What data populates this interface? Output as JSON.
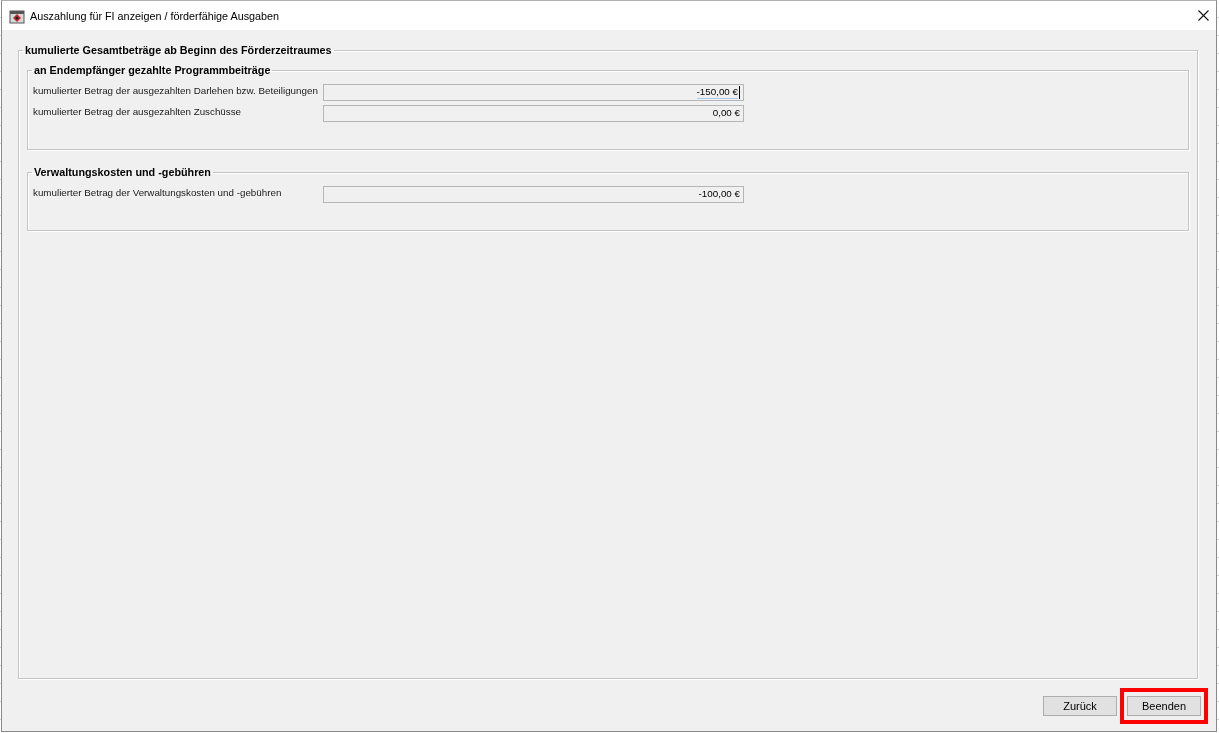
{
  "window": {
    "title": "Auszahlung für FI anzeigen / förderfähige Ausgaben"
  },
  "group": {
    "title": "kumulierte Gesamtbeträge ab Beginn des Förderzeitraumes",
    "sections": [
      {
        "title": "an Endempfänger gezahlte Programmbeiträge",
        "fields": [
          {
            "label": "kumulierter Betrag der ausgezahlten Darlehen bzw. Beteiligungen",
            "value": "-150,00 €",
            "focused": true
          },
          {
            "label": "kumulierter Betrag der ausgezahlten Zuschüsse",
            "value": "0,00 €",
            "focused": false
          }
        ]
      },
      {
        "title": "Verwaltungskosten und -gebühren",
        "fields": [
          {
            "label": "kumulierter Betrag der Verwaltungskosten und -gebühren",
            "value": "-100,00 €",
            "focused": false
          }
        ]
      }
    ]
  },
  "buttons": [
    {
      "label": "Zurück",
      "highlighted": false
    },
    {
      "label": "Beenden",
      "highlighted": true
    }
  ]
}
